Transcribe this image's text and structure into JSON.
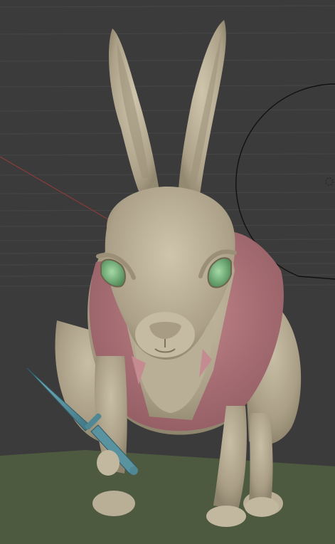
{
  "viewport": {
    "background_color": "#3b3b3b",
    "grid_color": "#474747",
    "ground_color": "#4e5a40",
    "x_axis_color": "#8a3b3b",
    "gizmo_circle_color": "#111111"
  },
  "model": {
    "body_color": "#b5aa92",
    "vest_color": "#b07378",
    "eye_color": "#79b07d",
    "blade_color": "#5a93a0"
  }
}
